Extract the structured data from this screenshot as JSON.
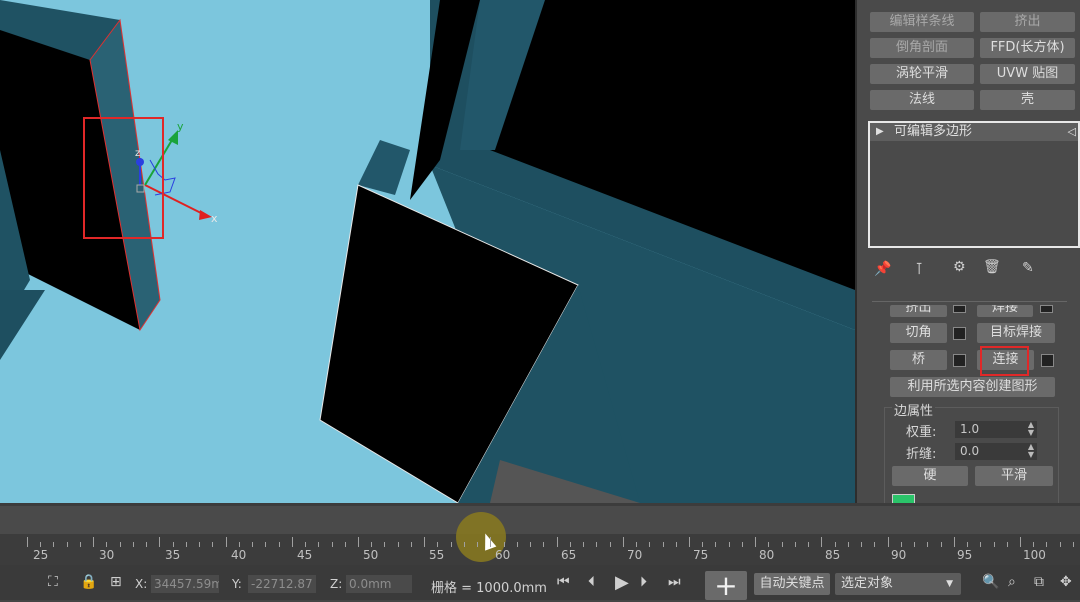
{
  "modifier_buttons": {
    "edit_spline": "编辑样条线",
    "extrude": "挤出",
    "bevel_profile": "倒角剖面",
    "ffd_box": "FFD(长方体)",
    "turbosmooth": "涡轮平滑",
    "uvw_map": "UVW 贴图",
    "normal": "法线",
    "shell": "壳"
  },
  "modifier_stack": {
    "item": "可编辑多边形"
  },
  "edit_edges": {
    "extrude_partial": "挤出",
    "weld_partial": "焊接",
    "chamfer": "切角",
    "target_weld": "目标焊接",
    "bridge": "桥",
    "connect": "连接",
    "create_shape": "利用所选内容创建图形"
  },
  "edge_properties": {
    "title": "边属性",
    "weight_label": "权重:",
    "weight_value": "1.0",
    "crease_label": "折缝:",
    "crease_value": "0.0",
    "hard": "硬",
    "smooth": "平滑",
    "show_partial": "显示硬边"
  },
  "timeline": {
    "ticks": [
      "25",
      "30",
      "35",
      "40",
      "45",
      "50",
      "55",
      "60",
      "65",
      "70",
      "75",
      "80",
      "85",
      "90",
      "95",
      "100"
    ]
  },
  "status": {
    "x_label": "X:",
    "x_value": "34457.59m",
    "y_label": "Y:",
    "y_value": "-22712.87",
    "z_label": "Z:",
    "z_value": "0.0mm",
    "grid": "栅格 = 1000.0mm",
    "auto_key": "自动关键点",
    "selected": "选定对象"
  },
  "gizmo": {
    "x": "x",
    "y": "y",
    "z": "z"
  },
  "colors": {
    "viewport_bg": "#7cc6dd",
    "highlight_red": "#e02828",
    "panel_bg": "#4a4a4a",
    "button_bg": "#6a6a6a"
  }
}
